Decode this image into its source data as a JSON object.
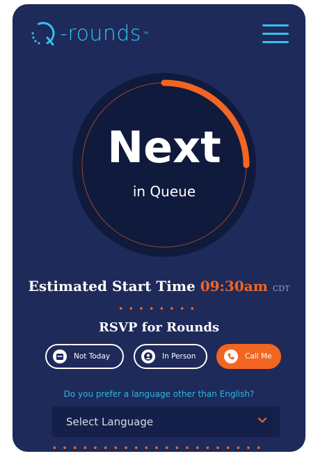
{
  "header": {
    "logo_text": "-rounds",
    "logo_tm": "™",
    "menu_icon": "hamburger-menu-icon"
  },
  "queue": {
    "headline": "Next",
    "subline": "in Queue",
    "progress": 0.25
  },
  "estimate": {
    "label": "Estimated Start Time",
    "time": "09:30am",
    "timezone": "CDT"
  },
  "rsvp": {
    "title": "RSVP for Rounds",
    "buttons": [
      {
        "label": "Not Today",
        "icon": "calendar-icon"
      },
      {
        "label": "In Person",
        "icon": "person-icon"
      },
      {
        "label": "Call Me",
        "icon": "phone-icon"
      }
    ]
  },
  "language": {
    "question": "Do you prefer a language other than English?",
    "selected": "Select Language"
  },
  "colors": {
    "background": "#1e2a59",
    "accent": "#f26522",
    "brand": "#35c2ef"
  }
}
